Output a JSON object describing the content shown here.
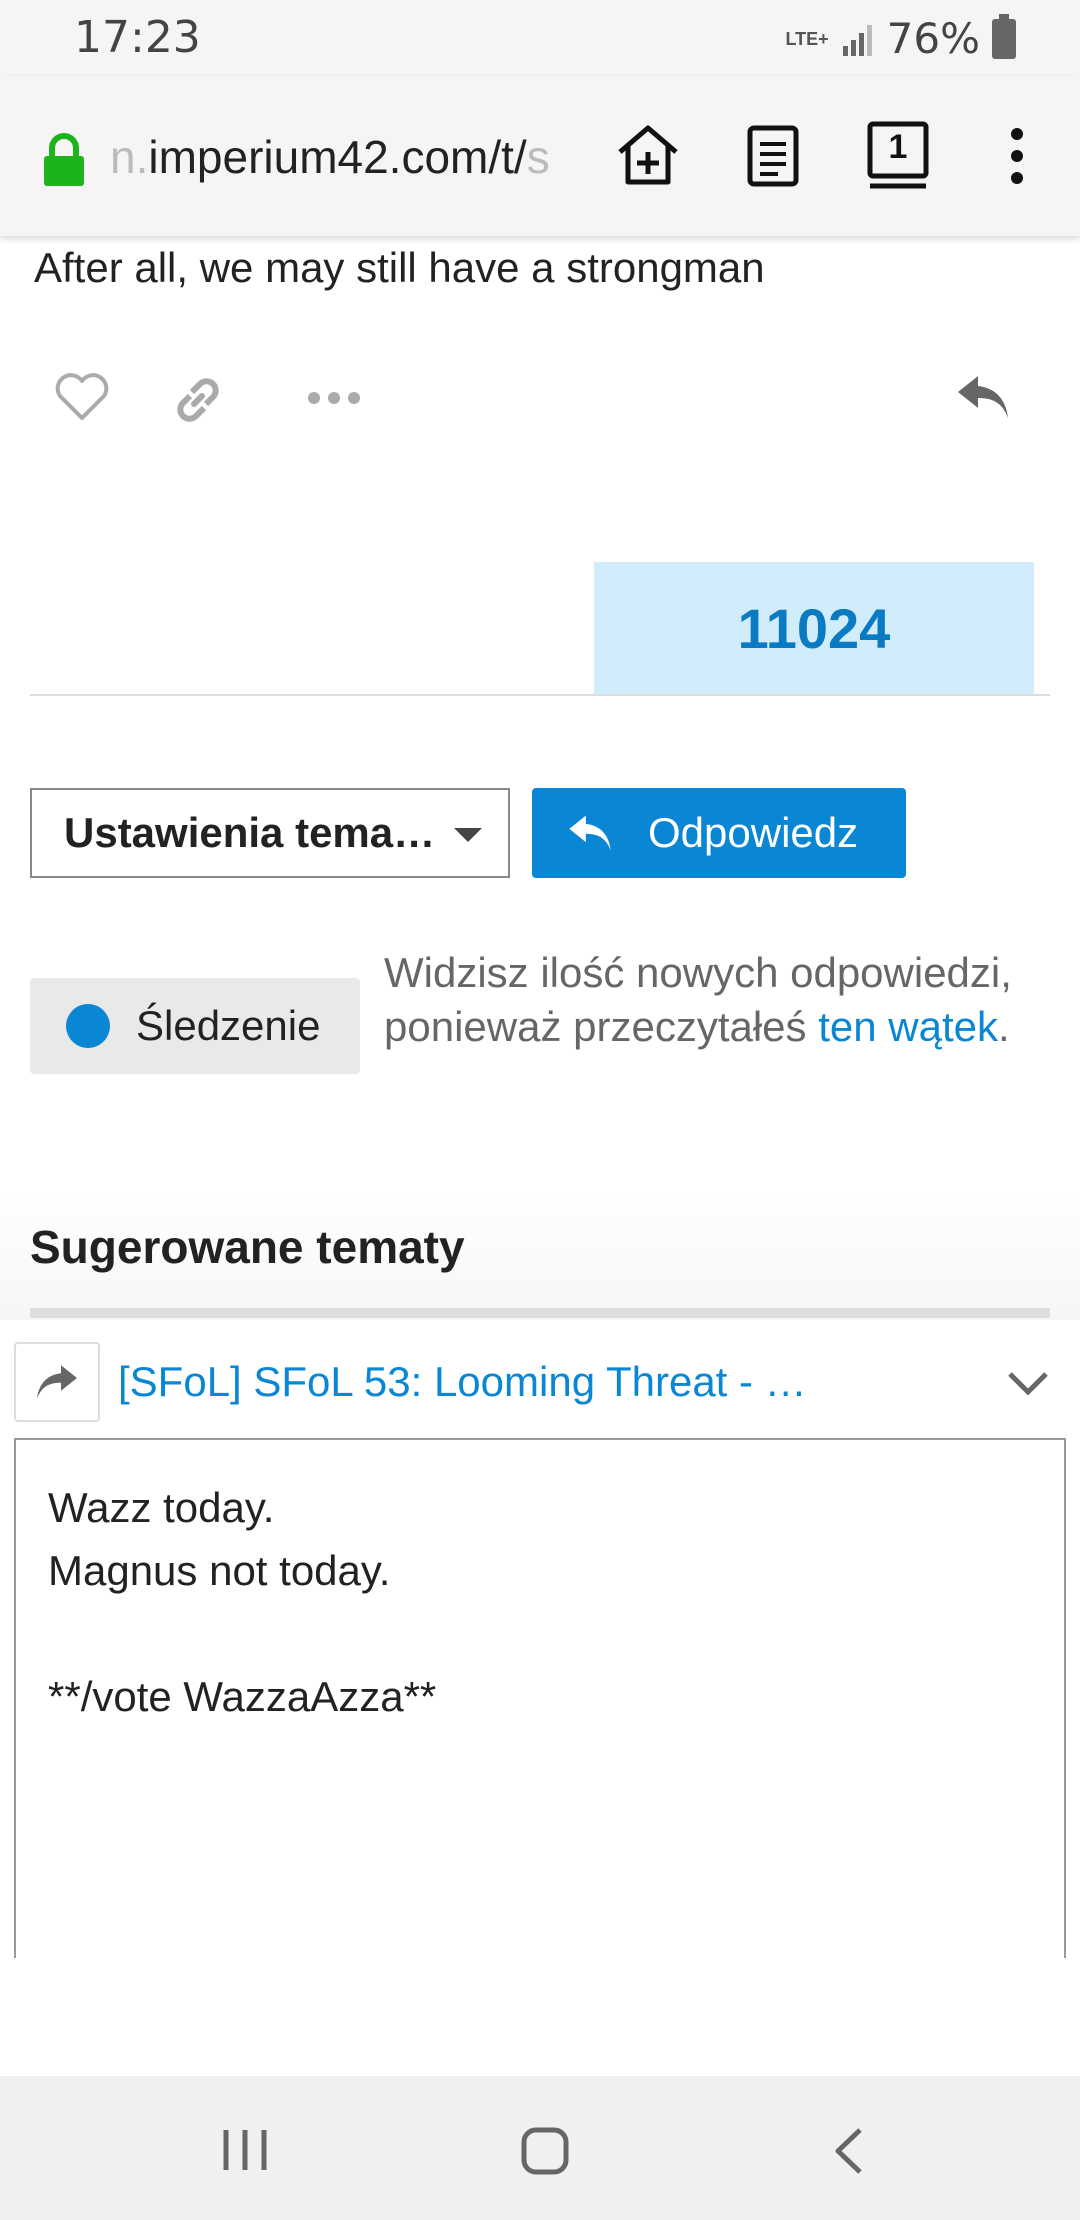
{
  "status_bar": {
    "time": "17:23",
    "network": "LTE+",
    "battery": "76%"
  },
  "browser": {
    "url_prefix": "n.",
    "url_main": "imperium42.com/t/",
    "url_suffix": "s",
    "tab_count": "1",
    "icons": [
      "lock-icon",
      "add-to-home-icon",
      "reader-mode-icon",
      "tabs-icon",
      "overflow-menu-icon"
    ]
  },
  "post": {
    "text": "After all, we may still have a strongman",
    "actions": [
      "heart-icon",
      "link-icon",
      "more-icon",
      "reply-icon"
    ]
  },
  "counter": "11024",
  "topic_controls": {
    "settings_label": "Ustawienia tema…",
    "reply_label": "Odpowiedz"
  },
  "tracking": {
    "button_label": "Śledzenie",
    "desc_before": "Widzisz ilość nowych odpowiedzi, ponieważ przeczytałeś ",
    "desc_link": "ten wątek",
    "desc_after": "."
  },
  "suggested": {
    "heading": "Sugerowane tematy"
  },
  "composer": {
    "title": "[SFoL] SFoL 53: Looming Threat - …",
    "body": "Wazz today.\nMagnus not today.\n\n**/vote WazzaAzza**"
  },
  "colors": {
    "accent": "#0a87d4",
    "counter_bg": "#d1ecfa",
    "lock_green": "#1db31d"
  }
}
